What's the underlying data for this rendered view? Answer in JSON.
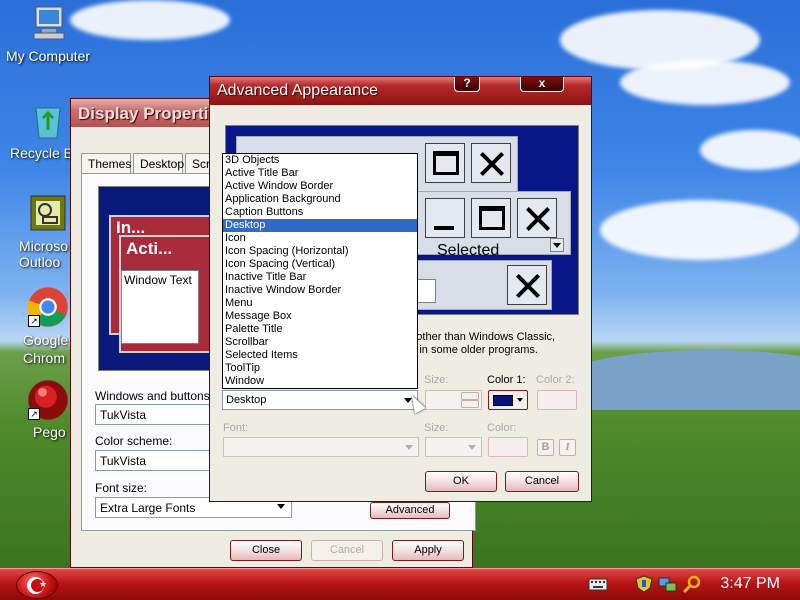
{
  "desktop": {
    "icons": [
      {
        "label": "My Computer",
        "icon": "computer-icon"
      },
      {
        "label": "Recycle B",
        "icon": "recycle-bin-icon"
      },
      {
        "label": "Microso Outloo",
        "icon": "outlook-icon"
      },
      {
        "label": "Google Chrom",
        "icon": "chrome-icon"
      },
      {
        "label": "Pego",
        "icon": "pego-icon"
      }
    ]
  },
  "display_properties": {
    "title": "Display Properti",
    "tabs": [
      "Themes",
      "Desktop",
      "Scre"
    ],
    "preview": {
      "inactive_title": "In...",
      "active_title": "Acti...",
      "window_text": "Window Text"
    },
    "windows_buttons_label": "Windows and buttons:",
    "windows_buttons_value": "TukVista",
    "color_scheme_label": "Color scheme:",
    "color_scheme_value": "TukVista",
    "font_size_label": "Font size:",
    "font_size_value": "Extra Large Fonts",
    "advanced_button": "Advanced",
    "close_button": "Close",
    "cancel_button": "Cancel",
    "apply_button": "Apply"
  },
  "advanced_appearance": {
    "title": "Advanced Appearance",
    "help_button": "?",
    "close_button": "x",
    "preview_selected": "Selected",
    "note_line1": "ng other than Windows Classic,",
    "note_line2": "ept in some older programs.",
    "item_value": "Desktop",
    "size_label": "Size:",
    "color1_label": "Color 1:",
    "color1_value": "#0a1078",
    "color2_label": "Color 2:",
    "font_label": "Font:",
    "font_size_label": "Size:",
    "font_color_label": "Color:",
    "bold_button": "B",
    "italic_button": "I",
    "ok_button": "OK",
    "cancel_button": "Cancel",
    "dropdown_items": [
      "3D Objects",
      "Active Title Bar",
      "Active Window Border",
      "Application Background",
      "Caption Buttons",
      "Desktop",
      "Icon",
      "Icon Spacing (Horizontal)",
      "Icon Spacing (Vertical)",
      "Inactive Title Bar",
      "Inactive Window Border",
      "Menu",
      "Message Box",
      "Palette Title",
      "Scrollbar",
      "Selected Items",
      "ToolTip",
      "Window"
    ],
    "selected_index": 5
  },
  "taskbar": {
    "clock": "3:47 PM",
    "tray_icons": [
      "keyboard-icon",
      "security-shield-icon",
      "network-icon",
      "search-icon"
    ]
  }
}
